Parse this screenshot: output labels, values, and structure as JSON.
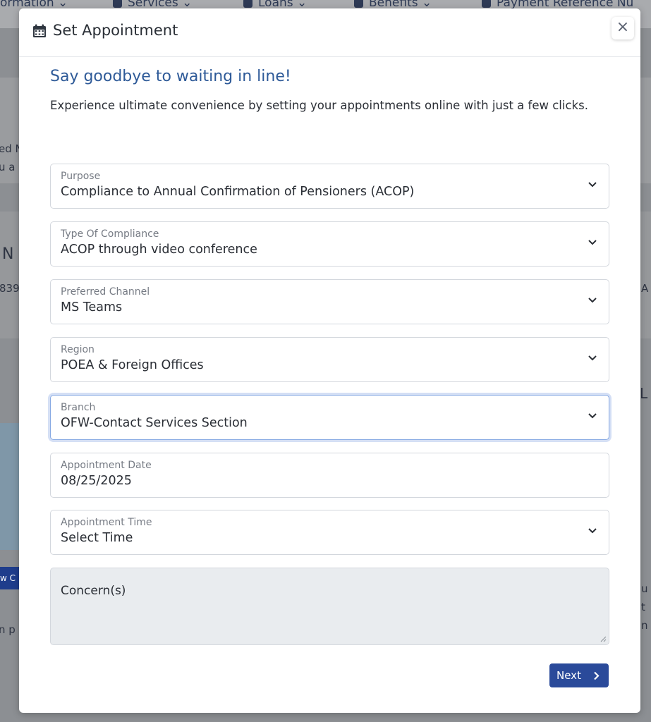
{
  "background": {
    "nav_items": [
      "ormation ⌄",
      "Services ⌄",
      "Loans ⌄",
      "Benefits ⌄",
      "Payment Reference Nu"
    ],
    "fragments": [
      "ed N",
      "u a",
      "N",
      "839",
      "A",
      "L",
      "u",
      "t",
      "n",
      "n p"
    ],
    "button_label": "w C"
  },
  "modal": {
    "title": "Set Appointment",
    "close_label": "×",
    "headline": "Say goodbye to waiting in line!",
    "subtext": "Experience ultimate convenience by setting your appointments online with just a few clicks."
  },
  "form": {
    "purpose": {
      "label": "Purpose",
      "value": "Compliance to Annual Confirmation of Pensioners (ACOP)"
    },
    "compliance_type": {
      "label": "Type Of Compliance",
      "value": "ACOP through video conference"
    },
    "channel": {
      "label": "Preferred Channel",
      "value": "MS Teams"
    },
    "region": {
      "label": "Region",
      "value": "POEA & Foreign Offices"
    },
    "branch": {
      "label": "Branch",
      "value": "OFW-Contact Services Section"
    },
    "date": {
      "label": "Appointment Date",
      "value": "08/25/2025"
    },
    "time": {
      "label": "Appointment Time",
      "value": "Select Time"
    },
    "concerns": {
      "placeholder": "Concern(s)"
    },
    "next_label": "Next"
  },
  "colors": {
    "accent": "#2a4a9a",
    "headline": "#2e5a98",
    "focus_border": "#86a9e3"
  },
  "icons": {
    "title": "calendar-icon",
    "close": "close-icon",
    "select": "chevron-down-icon",
    "next": "chevron-right-icon"
  }
}
